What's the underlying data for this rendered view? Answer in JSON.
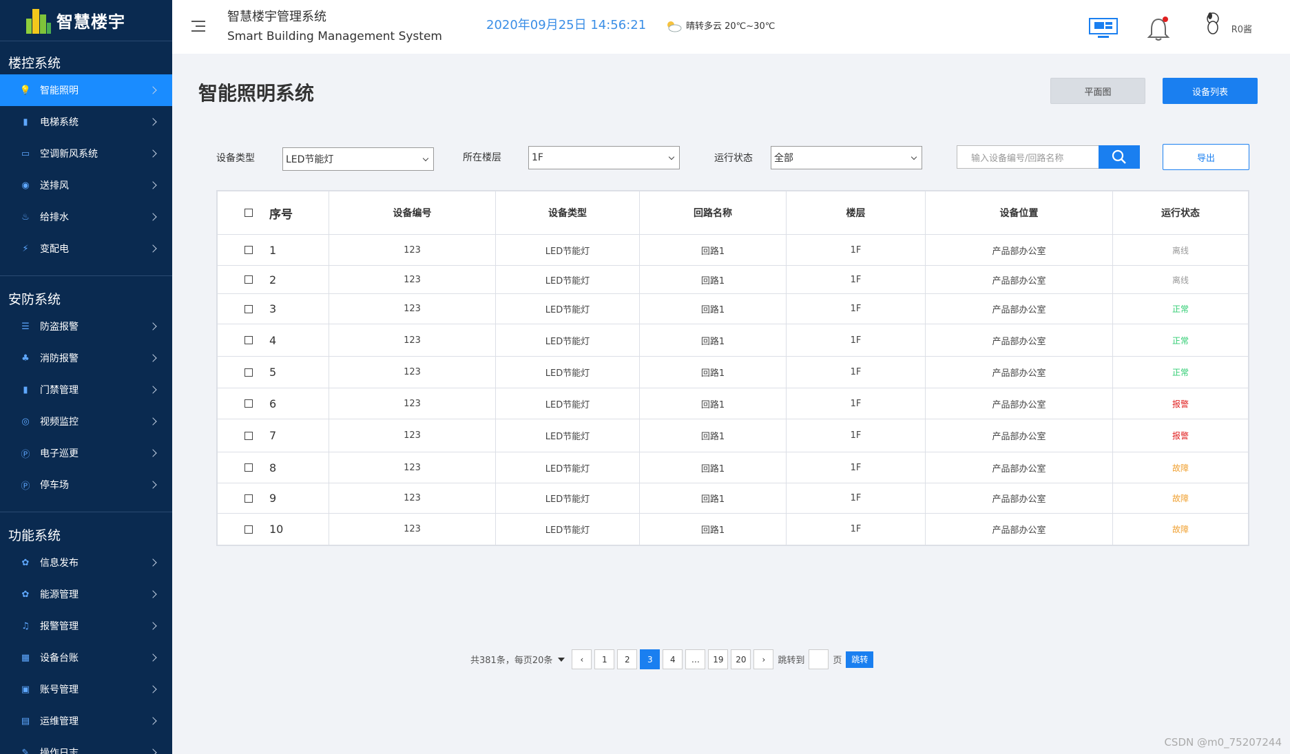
{
  "app": {
    "logo_text": "智慧楼宇",
    "title_cn": "智慧楼宇管理系统",
    "title_en": "Smart Building Management System",
    "datetime": "2020年09月25日 14:56:21",
    "weather": "晴转多云 20℃~30℃",
    "user": "R0酱"
  },
  "sidebar": {
    "groups": [
      {
        "title": "楼控系统",
        "items": [
          {
            "label": "智能照明",
            "icon": "bulb-icon",
            "active": true
          },
          {
            "label": "电梯系统",
            "icon": "elevator-icon"
          },
          {
            "label": "空调新风系统",
            "icon": "aircon-icon"
          },
          {
            "label": "送排风",
            "icon": "location-icon"
          },
          {
            "label": "给排水",
            "icon": "water-icon"
          },
          {
            "label": "变配电",
            "icon": "power-icon"
          }
        ]
      },
      {
        "title": "安防系统",
        "items": [
          {
            "label": "防盗报警",
            "icon": "list-icon"
          },
          {
            "label": "消防报警",
            "icon": "fire-icon"
          },
          {
            "label": "门禁管理",
            "icon": "door-icon"
          },
          {
            "label": "视频监控",
            "icon": "camera-icon"
          },
          {
            "label": "电子巡更",
            "icon": "patrol-icon"
          },
          {
            "label": "停车场",
            "icon": "parking-icon"
          }
        ]
      },
      {
        "title": "功能系统",
        "items": [
          {
            "label": "信息发布",
            "icon": "info-icon"
          },
          {
            "label": "能源管理",
            "icon": "energy-icon"
          },
          {
            "label": "报警管理",
            "icon": "bell-icon"
          },
          {
            "label": "设备台账",
            "icon": "device-icon"
          },
          {
            "label": "账号管理",
            "icon": "account-icon"
          },
          {
            "label": "运维管理",
            "icon": "maintenance-icon"
          },
          {
            "label": "操作日志",
            "icon": "log-icon"
          }
        ]
      }
    ]
  },
  "page": {
    "title": "智能照明系统",
    "btn_floorplan": "平面图",
    "btn_device_list": "设备列表",
    "btn_export": "导出"
  },
  "filters": {
    "type_label": "设备类型",
    "type_value": "LED节能灯",
    "floor_label": "所在楼层",
    "floor_value": "1F",
    "status_label": "运行状态",
    "status_value": "全部",
    "search_placeholder": "输入设备编号/回路名称"
  },
  "table": {
    "headers": [
      "序号",
      "设备编号",
      "设备类型",
      "回路名称",
      "楼层",
      "设备位置",
      "运行状态"
    ],
    "rows": [
      {
        "idx": "1",
        "code": "123",
        "type": "LED节能灯",
        "circuit": "回路1",
        "floor": "1F",
        "location": "产品部办公室",
        "status": "离线"
      },
      {
        "idx": "2",
        "code": "123",
        "type": "LED节能灯",
        "circuit": "回路1",
        "floor": "1F",
        "location": "产品部办公室",
        "status": "离线"
      },
      {
        "idx": "3",
        "code": "123",
        "type": "LED节能灯",
        "circuit": "回路1",
        "floor": "1F",
        "location": "产品部办公室",
        "status": "正常"
      },
      {
        "idx": "4",
        "code": "123",
        "type": "LED节能灯",
        "circuit": "回路1",
        "floor": "1F",
        "location": "产品部办公室",
        "status": "正常"
      },
      {
        "idx": "5",
        "code": "123",
        "type": "LED节能灯",
        "circuit": "回路1",
        "floor": "1F",
        "location": "产品部办公室",
        "status": "正常"
      },
      {
        "idx": "6",
        "code": "123",
        "type": "LED节能灯",
        "circuit": "回路1",
        "floor": "1F",
        "location": "产品部办公室",
        "status": "报警"
      },
      {
        "idx": "7",
        "code": "123",
        "type": "LED节能灯",
        "circuit": "回路1",
        "floor": "1F",
        "location": "产品部办公室",
        "status": "报警"
      },
      {
        "idx": "8",
        "code": "123",
        "type": "LED节能灯",
        "circuit": "回路1",
        "floor": "1F",
        "location": "产品部办公室",
        "status": "故障"
      },
      {
        "idx": "9",
        "code": "123",
        "type": "LED节能灯",
        "circuit": "回路1",
        "floor": "1F",
        "location": "产品部办公室",
        "status": "故障"
      },
      {
        "idx": "10",
        "code": "123",
        "type": "LED节能灯",
        "circuit": "回路1",
        "floor": "1F",
        "location": "产品部办公室",
        "status": "故障"
      }
    ]
  },
  "status_colors": {
    "离线": "#999999",
    "正常": "#2ecc71",
    "报警": "#e02020",
    "故障": "#f0a030"
  },
  "pagination": {
    "summary": "共381条，每页20条",
    "prev": "‹",
    "pages": [
      "1",
      "2",
      "3",
      "4",
      "…",
      "19",
      "20"
    ],
    "current": "3",
    "next": "›",
    "jump_label": "跳转到",
    "page_unit": "页",
    "jump_btn": "跳转"
  },
  "watermark": "CSDN @m0_75207244"
}
